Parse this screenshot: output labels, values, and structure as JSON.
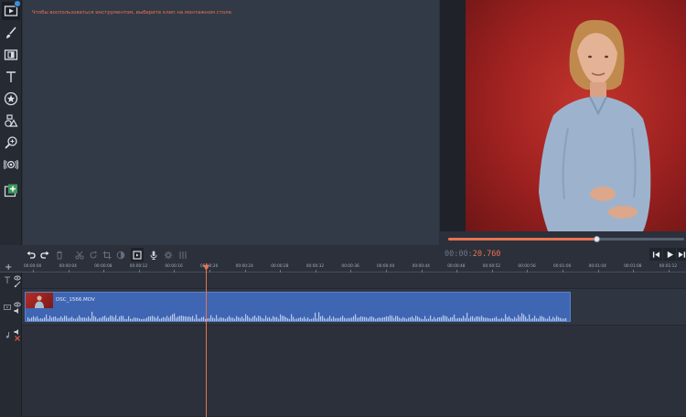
{
  "tool_panel": {
    "hint": "Чтобы воспользоваться инструментом, выберите клип на монтажном столе."
  },
  "toolstrip": [
    {
      "name": "import-icon",
      "glyph": "clapper"
    },
    {
      "name": "brush-icon",
      "glyph": "brush"
    },
    {
      "name": "transitions-icon",
      "glyph": "transitions"
    },
    {
      "name": "titles-icon",
      "glyph": "T"
    },
    {
      "name": "stickers-icon",
      "glyph": "star"
    },
    {
      "name": "callouts-icon",
      "glyph": "shapes"
    },
    {
      "name": "zoom-icon",
      "glyph": "zoom"
    },
    {
      "name": "stabilization-icon",
      "glyph": "camera"
    },
    {
      "name": "more-tools-icon",
      "glyph": "plus"
    }
  ],
  "player": {
    "timecode_prefix": "00:00:",
    "timecode_value": "20.760",
    "progress": 0.63,
    "colors": {
      "accent": "#e8734f",
      "background": "#c0312b"
    }
  },
  "timeline": {
    "add_track": "+",
    "ticks": [
      "00:00:00",
      "00:00:04",
      "00:00:08",
      "00:00:12",
      "00:00:16",
      "00:00:20",
      "00:00:24",
      "00:00:28",
      "00:00:32",
      "00:00:36",
      "00:00:40",
      "00:00:44",
      "00:00:48",
      "00:00:52",
      "00:00:56",
      "00:01:00",
      "00:01:04",
      "00:01:08",
      "00:01:12"
    ],
    "clip_name": "DSC_1566.MOV",
    "playhead_time": "00:00:20.760"
  }
}
